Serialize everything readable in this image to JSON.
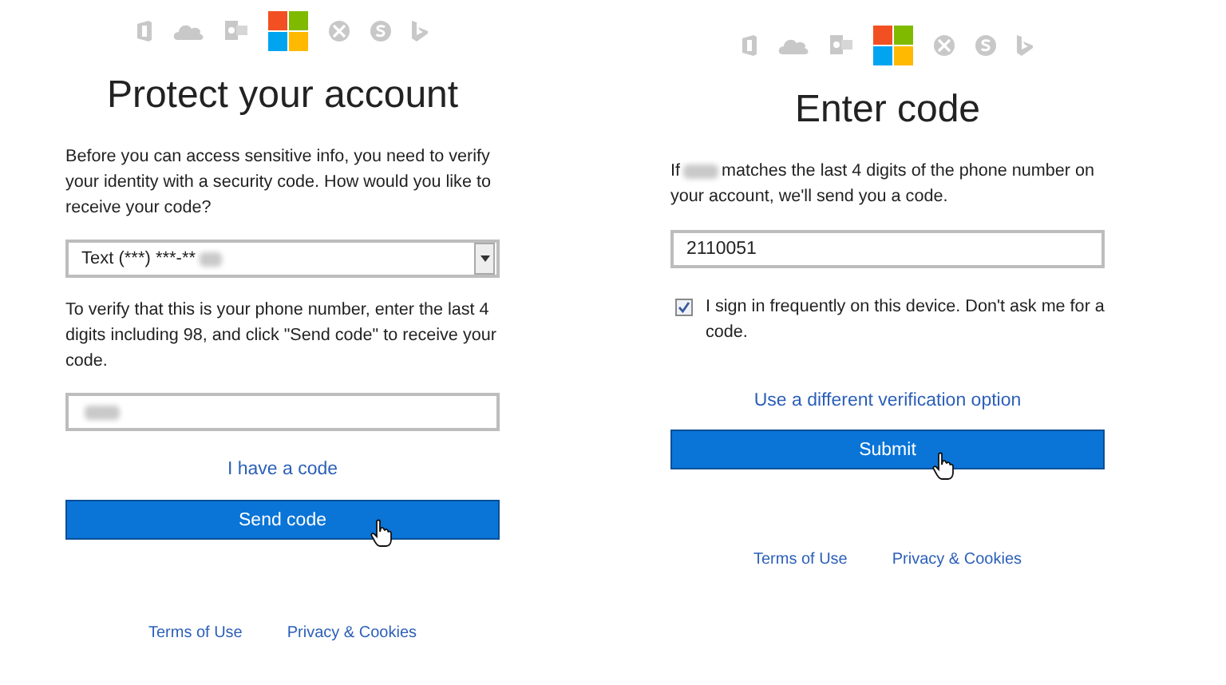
{
  "panels": [
    {
      "kind": "protect",
      "title": "Protect your account",
      "intro": "Before you can access sensitive info, you need to verify your identity with a security code. How would you like to receive your code?",
      "select": {
        "value": "Text (***) ***-**",
        "redacted": true
      },
      "instructions": "To verify that this is your phone number, enter the last 4 digits including 98, and click \"Send code\" to receive your code.",
      "input": {
        "redacted": true
      },
      "link": "I have a code",
      "button": "Send code",
      "footer": [
        "Terms of Use",
        "Privacy & Cookies"
      ]
    },
    {
      "kind": "enter",
      "title": "Enter code",
      "intro_before": "If",
      "intro_redacted": true,
      "intro_after": "matches the last 4 digits of the phone number on your account, we'll send you a code.",
      "input": {
        "value": "2110051"
      },
      "checkbox": {
        "label": "I sign in frequently on this device. Don't ask me for a code.",
        "checked": true
      },
      "link": "Use a different verification option",
      "button": "Submit",
      "footer": [
        "Terms of Use",
        "Privacy & Cookies"
      ]
    }
  ]
}
